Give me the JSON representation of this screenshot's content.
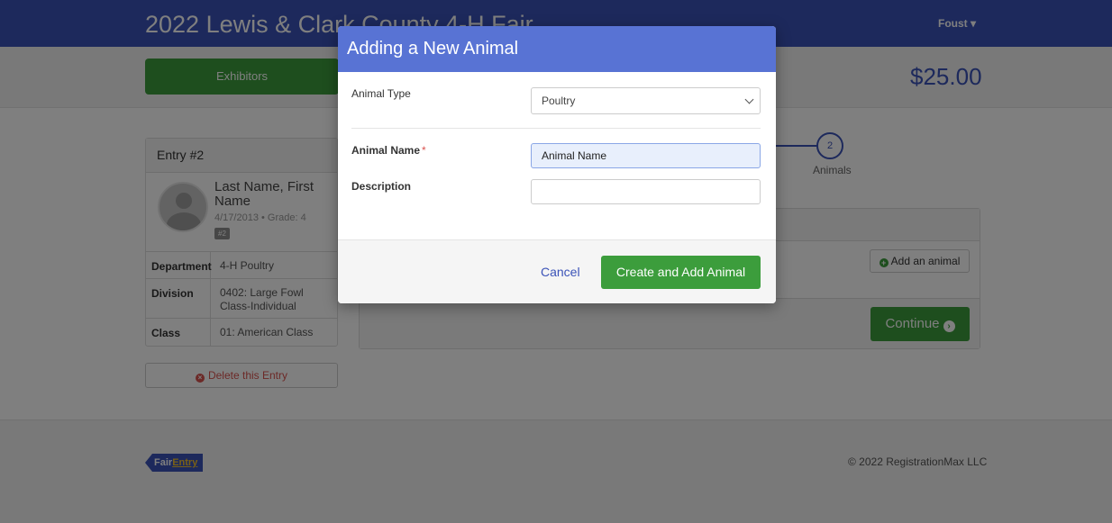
{
  "header": {
    "app_title": "2022 Lewis & Clark County 4-H Fair",
    "user_menu": "Foust ▾"
  },
  "nav": {
    "exhibitors_label": "Exhibitors",
    "cart_total": "$25.00"
  },
  "entry": {
    "title": "Entry #2",
    "person_name": "Last Name, First Name",
    "person_meta": "4/17/2013 • Grade: 4",
    "badge": "#2",
    "rows": [
      {
        "key": "Department",
        "value": "4-H Poultry"
      },
      {
        "key": "Division",
        "value": "0402: Large Fowl Class-Individual"
      },
      {
        "key": "Class",
        "value": "01: American Class"
      }
    ],
    "delete_label": "Delete this Entry"
  },
  "steps": {
    "current_number": "2",
    "current_label": "Animals"
  },
  "animals_panel": {
    "add_label": "Add an animal",
    "continue_label": "Continue"
  },
  "footer": {
    "logo_part1": "Fair",
    "logo_part2": "Entry",
    "copyright": "© 2022 RegistrationMax LLC"
  },
  "modal": {
    "title": "Adding a New Animal",
    "animal_type_label": "Animal Type",
    "animal_type_value": "Poultry",
    "animal_name_label": "Animal Name",
    "required_mark": "*",
    "animal_name_value": "Animal Name",
    "description_label": "Description",
    "description_value": "",
    "cancel_label": "Cancel",
    "submit_label": "Create and Add Animal"
  },
  "colors": {
    "brand_blue": "#3b53b8",
    "modal_header": "#5873d4",
    "success_green": "#3c9d3c",
    "danger_red": "#d9534f"
  }
}
